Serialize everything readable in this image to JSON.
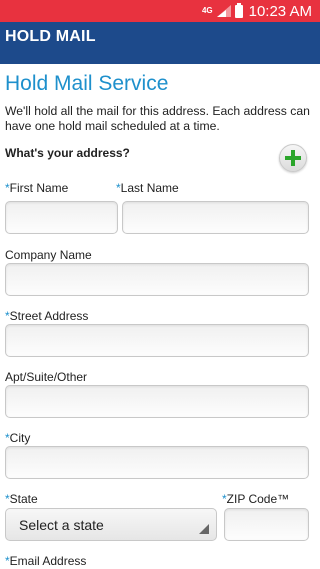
{
  "status_bar": {
    "network": "4G",
    "time": "10:23 AM",
    "color": "#e8323f"
  },
  "app_bar": {
    "title": "HOLD MAIL",
    "color": "#1d4a8b"
  },
  "page": {
    "title": "Hold Mail Service",
    "intro": "We'll hold all the mail for this address. Each address can have one hold mail scheduled at a time.",
    "section_label": "What's your address?"
  },
  "form": {
    "required_marker": "*",
    "first_name_label": "First Name",
    "last_name_label": "Last Name",
    "company_label": "Company Name",
    "street_label": "Street Address",
    "apt_label": "Apt/Suite/Other",
    "city_label": "City",
    "state_label": "State",
    "state_value": "Select a state",
    "zip_label": "ZIP Code™",
    "email_label": "Email Address"
  },
  "icons": {
    "add": "plus-icon",
    "dropdown": "dropdown-arrow-icon"
  },
  "colors": {
    "accent": "#1e90cc",
    "add_icon": "#2aa52a"
  }
}
